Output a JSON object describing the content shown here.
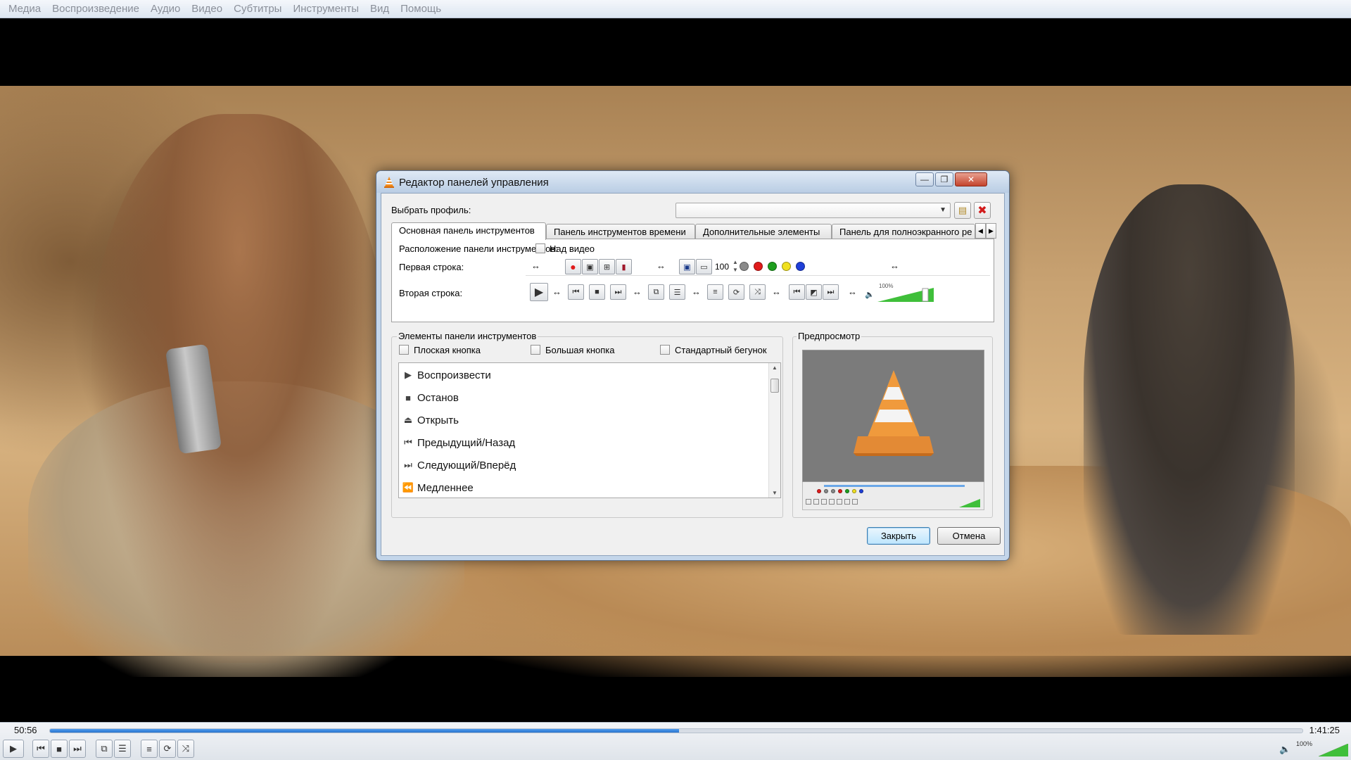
{
  "menu": [
    "Медиа",
    "Воспроизведение",
    "Аудио",
    "Видео",
    "Субтитры",
    "Инструменты",
    "Вид",
    "Помощь"
  ],
  "player": {
    "time_elapsed": "50:56",
    "time_total": "1:41:25",
    "progress_percent": 50.2,
    "volume_label": "100%",
    "volume_percent": 100
  },
  "dialog": {
    "title": "Редактор панелей управления",
    "profile_label": "Выбрать профиль:",
    "profile_value": "",
    "tabs": [
      "Основная панель инструментов",
      "Панель инструментов времени",
      "Дополнительные элементы",
      "Панель для полноэкранного ре"
    ],
    "active_tab": 0,
    "position_label": "Расположение панели инструментов:",
    "above_video_label": "Над видео",
    "row1_label": "Первая строка:",
    "row2_label": "Вторая строка:",
    "row1_number": "100",
    "row2_volume_label": "100%",
    "row1_colors": [
      "#8a8a8a",
      "#e01b1b",
      "#1e9e1e",
      "#f0e020",
      "#1f3fd8"
    ],
    "elements_group_title": "Элементы панели инструментов",
    "flat_button_label": "Плоская кнопка",
    "big_button_label": "Большая кнопка",
    "std_slider_label": "Стандартный бегунок",
    "elements": [
      {
        "label": "Воспроизвести",
        "icon": "play-icon"
      },
      {
        "label": "Останов",
        "icon": "stop-icon"
      },
      {
        "label": "Открыть",
        "icon": "eject-icon"
      },
      {
        "label": "Предыдущий/Назад",
        "icon": "previous-icon"
      },
      {
        "label": "Следующий/Вперёд",
        "icon": "next-icon"
      },
      {
        "label": "Медленнее",
        "icon": "slower-icon"
      }
    ],
    "preview_title": "Предпросмотр",
    "close_label": "Закрыть",
    "cancel_label": "Отмена"
  }
}
